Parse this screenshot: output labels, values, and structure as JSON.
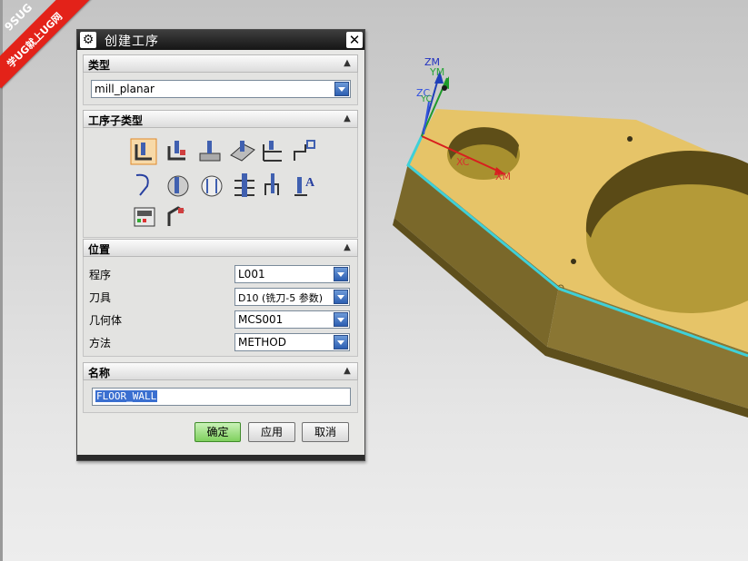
{
  "watermark": {
    "line1": "9SUG",
    "line2": "学UG就上UG网"
  },
  "dialog": {
    "title": "创建工序",
    "type_section": {
      "label": "类型",
      "value": "mill_planar"
    },
    "subtype_section": {
      "label": "工序子类型",
      "tools": [
        "floor-wall",
        "floor-wall-ipw",
        "face-milling",
        "face-milling-manual",
        "planar-mill",
        "planar-profile",
        "cleanup-corners",
        "finish-walls",
        "finish-floor",
        "hole-milling",
        "thread-milling",
        "planar-text",
        "mill-control",
        "mill-user"
      ]
    },
    "location_section": {
      "label": "位置",
      "rows": [
        {
          "label": "程序",
          "value": "L001"
        },
        {
          "label": "刀具",
          "value": "D10 (铣刀-5 参数)"
        },
        {
          "label": "几何体",
          "value": "MCS001"
        },
        {
          "label": "方法",
          "value": "METHOD"
        }
      ]
    },
    "name_section": {
      "label": "名称",
      "value": "FLOOR_WALL"
    },
    "buttons": {
      "ok": "确定",
      "apply": "应用",
      "cancel": "取消"
    }
  },
  "viewport": {
    "axes": {
      "zm": "ZM",
      "ym": "YM",
      "zc": "ZC",
      "yc": "YC",
      "xc": "XC",
      "xm": "XM"
    },
    "colors": {
      "part_top": "#e6c468",
      "part_side": "#7f6d2c",
      "toolpath": "#3fd0d8",
      "x_axis": "#d81e1e",
      "z_axis": "#1f3fb8",
      "y_axis": "#1e9a2a"
    }
  }
}
